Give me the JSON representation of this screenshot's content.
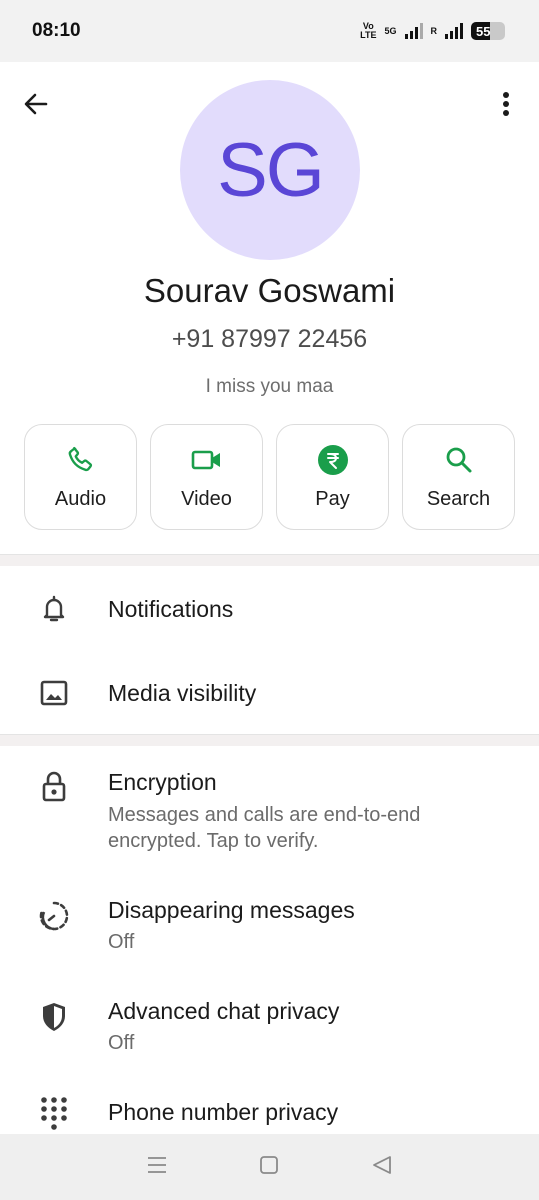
{
  "status_bar": {
    "time": "08:10",
    "volte": "Vo\nLTE",
    "network_5g": "5G",
    "roaming": "R",
    "battery": "55"
  },
  "contact": {
    "initials": "SG",
    "name": "Sourav Goswami",
    "phone": "+91 87997 22456",
    "about": "I miss you maa"
  },
  "actions": [
    {
      "label": "Audio",
      "icon": "phone-icon"
    },
    {
      "label": "Video",
      "icon": "video-icon"
    },
    {
      "label": "Pay",
      "icon": "rupee-icon"
    },
    {
      "label": "Search",
      "icon": "search-icon"
    }
  ],
  "settings_group_1": [
    {
      "title": "Notifications",
      "icon": "bell-icon"
    },
    {
      "title": "Media visibility",
      "icon": "image-icon"
    }
  ],
  "settings_group_2": [
    {
      "title": "Encryption",
      "subtitle": "Messages and calls are end-to-end encrypted. Tap to verify.",
      "icon": "lock-icon"
    },
    {
      "title": "Disappearing messages",
      "subtitle": "Off",
      "icon": "timer-icon"
    },
    {
      "title": "Advanced chat privacy",
      "subtitle": "Off",
      "icon": "shield-icon"
    },
    {
      "title": "Phone number privacy",
      "icon": "dialpad-icon"
    }
  ],
  "colors": {
    "accent_green": "#1a9e4b",
    "avatar_bg": "#e2dcfc",
    "avatar_text": "#5a46d6"
  }
}
